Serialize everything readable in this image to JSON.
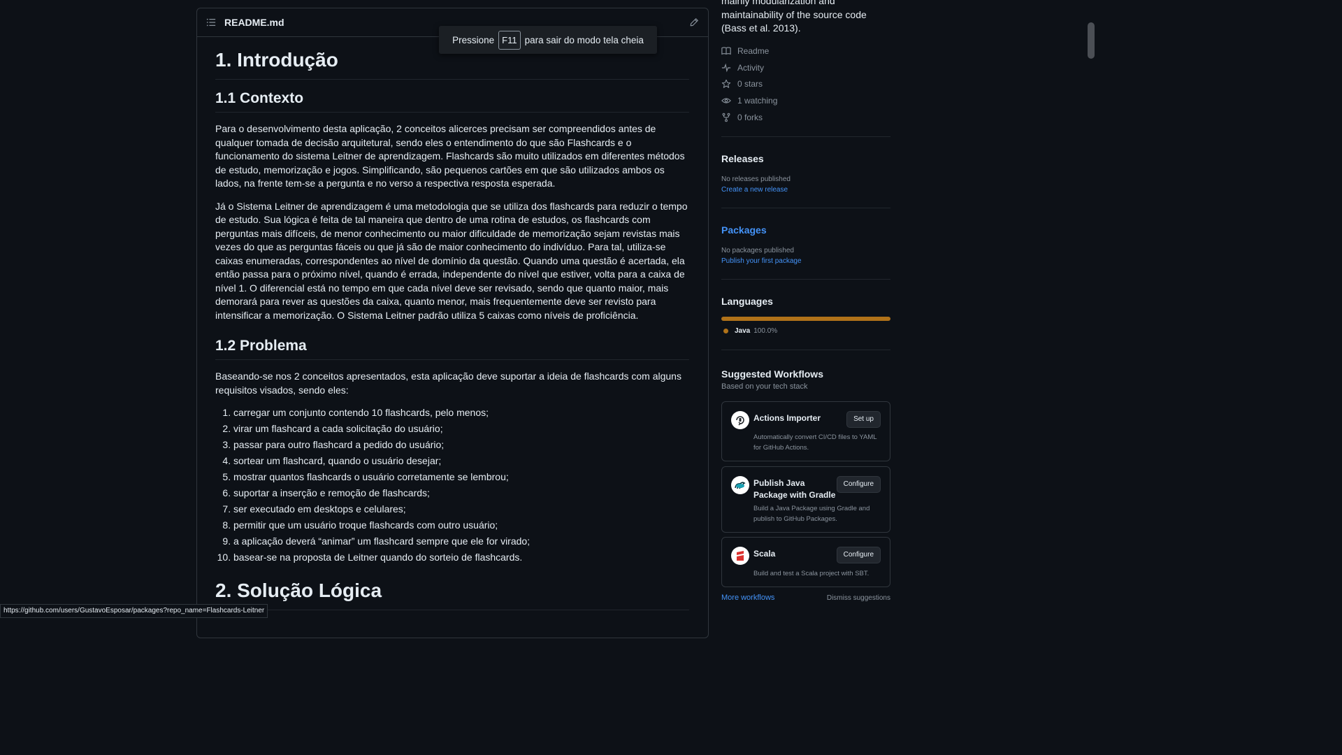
{
  "readme": {
    "title": "README.md",
    "h1_intro": "1. Introdução",
    "h2_contexto": "1.1 Contexto",
    "p_contexto_1": "Para o desenvolvimento desta aplicação, 2 conceitos alicerces precisam ser compreendidos antes de qualquer tomada de decisão arquitetural, sendo eles o entendimento do que são Flashcards e o funcionamento do sistema Leitner de aprendizagem. Flashcards são muito utilizados em diferentes métodos de estudo, memorização e jogos. Simplificando, são pequenos cartões em que são utilizados ambos os lados, na frente tem-se a pergunta e no verso a respectiva resposta esperada.",
    "p_contexto_2": "Já o Sistema Leitner de aprendizagem é uma metodologia que se utiliza dos flashcards para reduzir o tempo de estudo. Sua lógica é feita de tal maneira que dentro de uma rotina de estudos, os flashcards com perguntas mais difíceis, de menor conhecimento ou maior dificuldade de memorização sejam revistas mais vezes do que as perguntas fáceis ou que já são de maior conhecimento do indivíduo. Para tal, utiliza-se caixas enumeradas, correspondentes ao nível de domínio da questão. Quando uma questão é acertada, ela então passa para o próximo nível, quando é errada, independente do nível que estiver, volta para a caixa de nível 1. O diferencial está no tempo em que cada nível deve ser revisado, sendo que quanto maior, mais demorará para rever as questões da caixa, quanto menor, mais frequentemente deve ser revisto para intensificar a memorização. O Sistema Leitner padrão utiliza 5 caixas como níveis de proficiência.",
    "h2_problema": "1.2 Problema",
    "p_problema": "Baseando-se nos 2 conceitos apresentados, esta aplicação deve suportar a ideia de flashcards com alguns requisitos visados, sendo eles:",
    "requirements": [
      "carregar um conjunto contendo 10 flashcards, pelo menos;",
      "virar um flashcard a cada solicitação do usuário;",
      "passar para outro flashcard a pedido do usuário;",
      "sortear um flashcard, quando o usuário desejar;",
      "mostrar quantos flashcards o usuário corretamente se lembrou;",
      "suportar a inserção e remoção de flashcards;",
      "ser executado em desktops e celulares;",
      "permitir que um usuário troque flashcards com outro usuário;",
      "a aplicação deverá “animar” um flashcard sempre que ele for virado;",
      "basear-se na proposta de Leitner quando do sorteio de flashcards."
    ],
    "h1_solucao": "2. Solução Lógica"
  },
  "fullscreen_toast": {
    "before": "Pressione",
    "key": "F11",
    "after": "para sair do modo tela cheia"
  },
  "sidebar": {
    "about_text": "mainly modularization and maintainability of the source code (Bass et al. 2013).",
    "meta": {
      "readme": "Readme",
      "activity": "Activity",
      "stars": "0 stars",
      "watching": "1 watching",
      "forks": "0 forks"
    },
    "releases": {
      "title": "Releases",
      "empty": "No releases published",
      "link": "Create a new release"
    },
    "packages": {
      "title": "Packages",
      "empty": "No packages published",
      "link": "Publish your first package"
    },
    "languages": {
      "title": "Languages",
      "name": "Java",
      "percent": "100.0%",
      "percent_value": 100,
      "color": "#b07219"
    },
    "workflows": {
      "title": "Suggested Workflows",
      "subtitle": "Based on your tech stack",
      "cards": [
        {
          "title": "Actions Importer",
          "button": "Set up",
          "description": "Automatically convert CI/CD files to YAML for GitHub Actions."
        },
        {
          "title": "Publish Java Package with Gradle",
          "button": "Configure",
          "description": "Build a Java Package using Gradle and publish to GitHub Packages."
        },
        {
          "title": "Scala",
          "button": "Configure",
          "description": "Build and test a Scala project with SBT."
        }
      ],
      "more": "More workflows",
      "dismiss": "Dismiss suggestions"
    }
  },
  "status_bar": {
    "url": "https://github.com/users/GustavoEsposar/packages?repo_name=Flashcards-Leitner"
  },
  "colors": {
    "background": "#0d1117",
    "border": "#30363d",
    "link": "#4493f8",
    "muted": "#8b949e",
    "java": "#b07219"
  }
}
